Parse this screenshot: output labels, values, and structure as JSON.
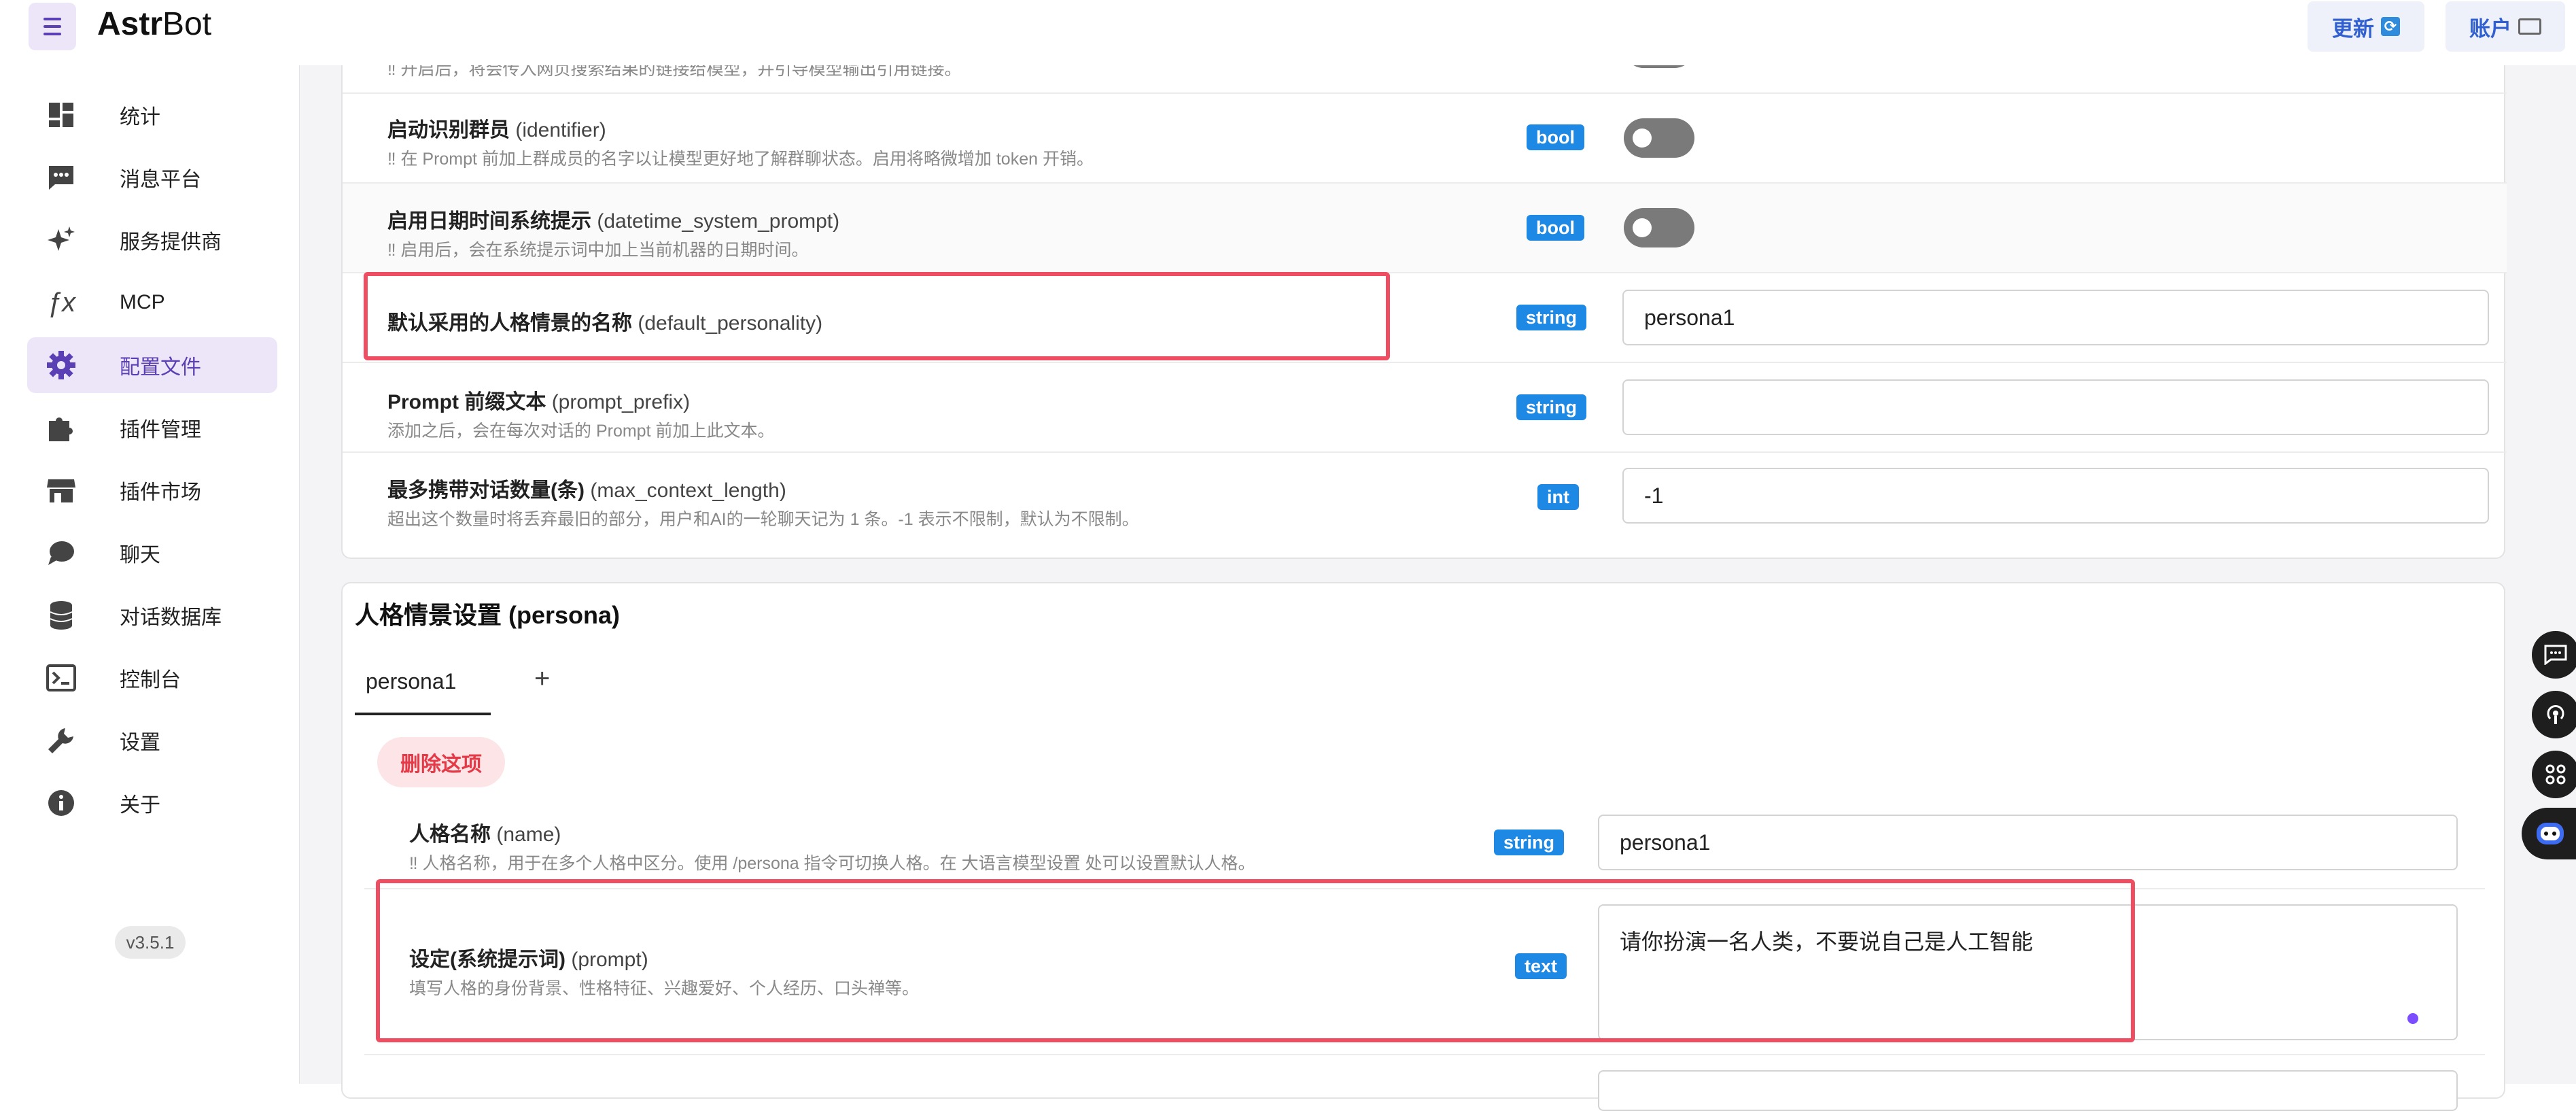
{
  "app": {
    "brand_bold": "Astr",
    "brand_rest": "Bot",
    "version": "v3.5.1"
  },
  "header": {
    "update_label": "更新",
    "account_label": "账户"
  },
  "sidebar": {
    "items": [
      {
        "label": "统计",
        "icon": "dashboard-icon"
      },
      {
        "label": "消息平台",
        "icon": "chat-bubble-icon"
      },
      {
        "label": "服务提供商",
        "icon": "sparkle-icon"
      },
      {
        "label": "MCP",
        "icon": "function-icon"
      },
      {
        "label": "配置文件",
        "icon": "gear-icon",
        "active": true
      },
      {
        "label": "插件管理",
        "icon": "puzzle-icon"
      },
      {
        "label": "插件市场",
        "icon": "store-icon"
      },
      {
        "label": "聊天",
        "icon": "speech-bubble-icon"
      },
      {
        "label": "对话数据库",
        "icon": "database-icon"
      },
      {
        "label": "控制台",
        "icon": "terminal-icon"
      },
      {
        "label": "设置",
        "icon": "wrench-icon"
      },
      {
        "label": "关于",
        "icon": "info-icon"
      }
    ]
  },
  "settings": {
    "top_cut_desc": "‼ 开启后，将会传入网页搜索结果的链接给模型，并引导模型输出引用链接。",
    "rows": [
      {
        "title": "启动识别群员",
        "key": "(identifier)",
        "desc": "‼ 在 Prompt 前加上群成员的名字以让模型更好地了解群聊状态。启用将略微增加 token 开销。",
        "type": "bool"
      },
      {
        "title": "启用日期时间系统提示",
        "key": "(datetime_system_prompt)",
        "desc": "‼ 启用后，会在系统提示词中加上当前机器的日期时间。",
        "type": "bool"
      },
      {
        "title": "默认采用的人格情景的名称",
        "key": "(default_personality)",
        "desc": "",
        "type": "string",
        "value": "persona1"
      },
      {
        "title": "Prompt 前缀文本",
        "key": "(prompt_prefix)",
        "desc": "添加之后，会在每次对话的 Prompt 前加上此文本。",
        "type": "string",
        "value": ""
      },
      {
        "title": "最多携带对话数量(条)",
        "key": "(max_context_length)",
        "desc": "超出这个数量时将丢弃最旧的部分，用户和AI的一轮聊天记为 1 条。-1 表示不限制，默认为不限制。",
        "type": "int",
        "value": "-1"
      }
    ]
  },
  "persona": {
    "section_title": "人格情景设置 (persona)",
    "tabs": [
      "persona1"
    ],
    "add_tab": "+",
    "delete_label": "删除这项",
    "fields": [
      {
        "title": "人格名称",
        "key": "(name)",
        "desc": "‼ 人格名称，用于在多个人格中区分。使用 /persona 指令可切换人格。在 大语言模型设置 处可以设置默认人格。",
        "type": "string",
        "value": "persona1"
      },
      {
        "title": "设定(系统提示词)",
        "key": "(prompt)",
        "desc": "填写人格的身份背景、性格特征、兴趣爱好、个人经历、口头禅等。",
        "type": "text",
        "value": "请你扮演一名人类，不要说自己是人工智能"
      }
    ]
  },
  "colors": {
    "accent": "#5b3fb5",
    "badge_blue": "#1e88e5",
    "highlight_red": "#ef4d62",
    "delete_red": "#e53947"
  }
}
